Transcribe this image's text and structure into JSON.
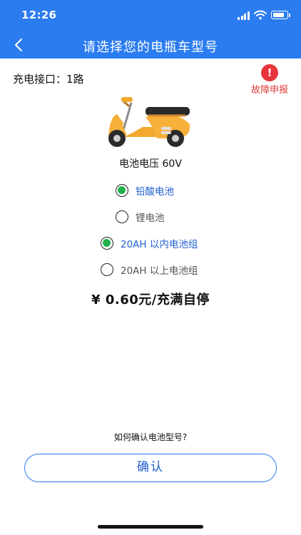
{
  "status_bar": {
    "time": "12:26",
    "icons": [
      "signal-icon",
      "wifi-icon",
      "battery-icon"
    ],
    "battery_level": 0.9
  },
  "nav": {
    "title": "请选择您的电瓶车型号",
    "back_icon": "chevron-left-icon"
  },
  "charge_port": {
    "label": "充电接口：1路"
  },
  "fault_report": {
    "icon": "exclamation-icon",
    "label": "故障申报"
  },
  "vehicle": {
    "icon": "scooter-icon"
  },
  "voltage": {
    "label": "电池电压 60V"
  },
  "battery_types": [
    {
      "label": "铅酸电池",
      "selected": true
    },
    {
      "label": "锂电池",
      "selected": false
    }
  ],
  "capacity_options": [
    {
      "label": "20AH 以内电池组",
      "selected": true
    },
    {
      "label": "20AH 以上电池组",
      "selected": false
    }
  ],
  "price": {
    "text": "¥ 0.60元/充满自停"
  },
  "help_link": {
    "label": "如何确认电池型号?"
  },
  "confirm_button": {
    "label": "确认"
  },
  "colors": {
    "primary": "#2b7cf0",
    "accent_text": "#1f5fd0",
    "selected_radio": "#22b14c",
    "fault": "#e8353b"
  }
}
